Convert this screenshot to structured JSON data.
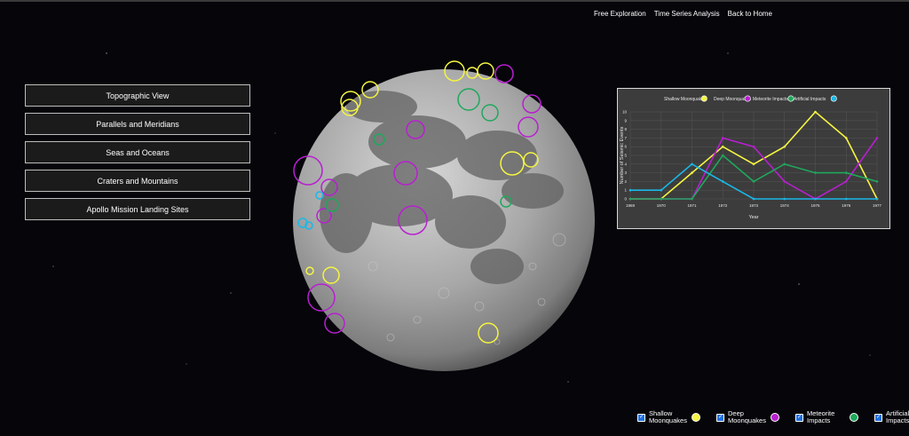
{
  "nav": {
    "free_exploration": "Free Exploration",
    "time_series": "Time Series Analysis",
    "back_home": "Back to Home"
  },
  "menu": [
    "Topographic View",
    "Parallels and Meridians",
    "Seas and Oceans",
    "Craters and Mountains",
    "Apollo Mission Landing Sites"
  ],
  "colors": {
    "shallow": "#f5f542",
    "deep": "#b81fd0",
    "meteorite": "#1fa85c",
    "artificial": "#1ab8e8"
  },
  "chart_data": {
    "type": "line",
    "ylabel": "Number of Seismic Events",
    "xlabel": "Year",
    "x": [
      "1969",
      "1970",
      "1971",
      "1972",
      "1973",
      "1974",
      "1975",
      "1976",
      "1977"
    ],
    "ylim": [
      0,
      10
    ],
    "yticks": [
      "0",
      "1",
      "2",
      "3",
      "4",
      "5",
      "6",
      "7",
      "8",
      "9",
      "10"
    ],
    "series": [
      {
        "name": "Shallow Moonquakes",
        "color": "#f5f542",
        "values": [
          0,
          0,
          3,
          6,
          4,
          6,
          10,
          7,
          0
        ]
      },
      {
        "name": "Deep Moonquakes",
        "color": "#b81fd0",
        "values": [
          0,
          0,
          0,
          7,
          6,
          2,
          0,
          2,
          7
        ]
      },
      {
        "name": "Meteorite Impacts",
        "color": "#1fa85c",
        "values": [
          0,
          0,
          0,
          5,
          2,
          4,
          3,
          3,
          2
        ]
      },
      {
        "name": "Artificial Impacts",
        "color": "#1ab8e8",
        "values": [
          1,
          1,
          4,
          2,
          0,
          0,
          0,
          0,
          0
        ]
      }
    ]
  },
  "bottom_legend": [
    {
      "label": "Shallow Moonquakes",
      "color": "#f5f542"
    },
    {
      "label": "Deep Moonquakes",
      "color": "#b81fd0"
    },
    {
      "label": "Meteorite Impacts",
      "color": "#1fa85c"
    },
    {
      "label": "Artificial Impacts",
      "color": "#1ab8e8"
    }
  ],
  "markers": [
    {
      "type": "shallow"
    },
    {
      "type": "shallow"
    },
    {
      "type": "shallow"
    },
    {
      "type": "shallow"
    },
    {
      "type": "shallow"
    },
    {
      "type": "shallow"
    },
    {
      "type": "shallow"
    },
    {
      "type": "shallow"
    },
    {
      "type": "shallow"
    },
    {
      "type": "shallow"
    },
    {
      "type": "shallow"
    },
    {
      "type": "deep"
    },
    {
      "type": "deep"
    },
    {
      "type": "deep"
    },
    {
      "type": "deep"
    },
    {
      "type": "deep"
    },
    {
      "type": "deep"
    },
    {
      "type": "deep"
    },
    {
      "type": "deep"
    },
    {
      "type": "deep"
    },
    {
      "type": "deep"
    },
    {
      "type": "deep"
    },
    {
      "type": "meteorite"
    },
    {
      "type": "meteorite"
    },
    {
      "type": "meteorite"
    },
    {
      "type": "meteorite"
    },
    {
      "type": "meteorite"
    },
    {
      "type": "artificial"
    },
    {
      "type": "artificial"
    },
    {
      "type": "artificial"
    }
  ]
}
